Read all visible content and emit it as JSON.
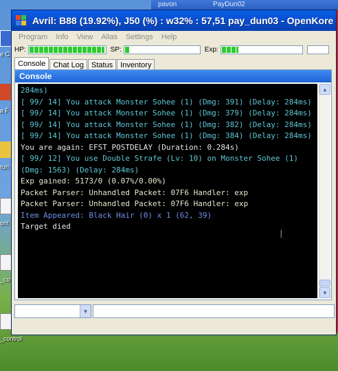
{
  "background": {
    "window_titles": [
      "pavon",
      "PayDun02"
    ],
    "desktop_labels": [
      "e C",
      "a F",
      "run",
      "ont",
      "_co",
      "_control"
    ]
  },
  "window": {
    "title": "Avril: B88 (19.92%), J50 (%) : w32% : 57,51 pay_dun03 - OpenKore"
  },
  "menu": [
    "Program",
    "Info",
    "View",
    "Alias",
    "Settings",
    "Help"
  ],
  "status": {
    "hp_label": "HP:",
    "sp_label": "SP:",
    "exp_label": "Exp:",
    "hp_fill": 0.99,
    "sp_fill": 0.08,
    "exp_fill": 0.22,
    "fill_color": "#2ecc2e"
  },
  "tabs": [
    "Console",
    "Chat Log",
    "Status",
    "Inventory"
  ],
  "panel": {
    "title": "Console"
  },
  "console": {
    "lines": [
      {
        "text": "284ms)",
        "color": "#5fc7d6"
      },
      {
        "text": "[ 99/ 14] You attack Monster Sohee (1) (Dmg: 391) (Delay: 284ms)",
        "color": "#5fc7d6"
      },
      {
        "text": "[ 99/ 14] You attack Monster Sohee (1) (Dmg: 379) (Delay: 284ms)",
        "color": "#5fc7d6"
      },
      {
        "text": "[ 99/ 14] You attack Monster Sohee (1) (Dmg: 382) (Delay: 284ms)",
        "color": "#5fc7d6"
      },
      {
        "text": "[ 99/ 14] You attack Monster Sohee (1) (Dmg: 384) (Delay: 284ms)",
        "color": "#5fc7d6"
      },
      {
        "text": "You are again: EFST_POSTDELAY (Duration: 0.284s)",
        "color": "#e8e8e8"
      },
      {
        "text": "[ 99/ 12] You use Double Strafe (Lv: 10) on Monster Sohee (1) (Dmg: 1563) (Delay: 284ms)",
        "color": "#5fc7d6"
      },
      {
        "text": "Exp gained: 5173/0 (0.07%/0.00%)",
        "color": "#e8e8d0"
      },
      {
        "text": "Packet Parser: Unhandled Packet: 07F6 Handler: exp",
        "color": "#e8e8d0"
      },
      {
        "text": "Packet Parser: Unhandled Packet: 07F6 Handler: exp",
        "color": "#e8e8d0"
      },
      {
        "text": "Item Appeared: Black Hair (0) x 1 (62, 39)",
        "color": "#6f8fe8"
      },
      {
        "text": "Target died",
        "color": "#e8e8e8"
      }
    ]
  },
  "colors": {
    "titlebar": "#0a4fd0",
    "panel_header": "#1e63d6",
    "console_bg": "#000000"
  },
  "icons": [
    "app-icon",
    "scroll-up-icon",
    "scroll-down-icon",
    "chevron-down-icon",
    "text-cursor-icon"
  ]
}
